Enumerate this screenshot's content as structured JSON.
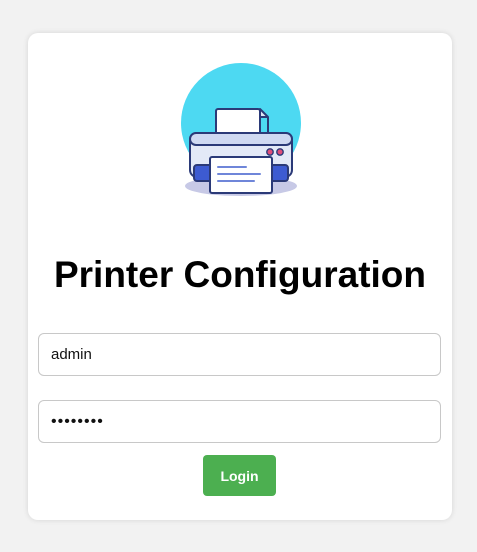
{
  "page": {
    "title": "Printer Configuration"
  },
  "logo": {
    "icon": "printer-icon",
    "circle_color": "#4dd9f2"
  },
  "form": {
    "username": {
      "value": "admin"
    },
    "password": {
      "value": "admin123"
    },
    "login_label": "Login"
  },
  "colors": {
    "background": "#f2f2f2",
    "card": "#ffffff",
    "login_button": "#4caf50",
    "login_text": "#ffffff",
    "title_text": "#000000"
  }
}
